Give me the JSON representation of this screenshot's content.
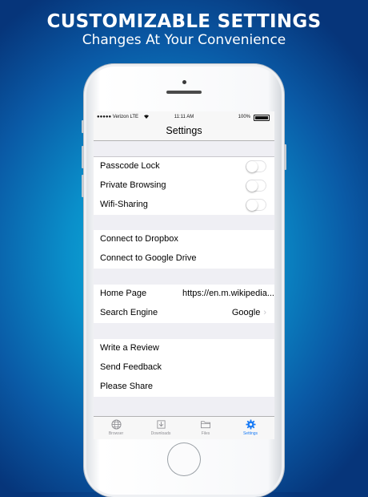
{
  "headline": "CUSTOMIZABLE SETTINGS",
  "subheadline": "Changes At Your Convenience",
  "status_bar": {
    "carrier": "●●●●● Verizon LTE",
    "time": "11:11 AM",
    "battery": "100%"
  },
  "nav": {
    "title": "Settings"
  },
  "sections": {
    "privacy": [
      {
        "label": "Passcode Lock",
        "toggle_on": false
      },
      {
        "label": "Private Browsing",
        "toggle_on": false
      },
      {
        "label": "Wifi-Sharing",
        "toggle_on": false
      }
    ],
    "cloud": [
      {
        "label": "Connect to Dropbox"
      },
      {
        "label": "Connect to Google Drive"
      }
    ],
    "browser": [
      {
        "label": "Home Page",
        "value": "https://en.m.wikipedia..."
      },
      {
        "label": "Search Engine",
        "value": "Google"
      }
    ],
    "feedback": [
      {
        "label": "Write a Review"
      },
      {
        "label": "Send Feedback"
      },
      {
        "label": "Please Share"
      }
    ]
  },
  "tab_bar": {
    "tabs": [
      {
        "label": "Browser",
        "icon": "globe-icon"
      },
      {
        "label": "Downloads",
        "icon": "download-icon"
      },
      {
        "label": "Files",
        "icon": "folder-icon"
      },
      {
        "label": "Settings",
        "icon": "gear-icon",
        "active": true
      }
    ]
  },
  "colors": {
    "accent": "#1b7cf5",
    "background_top": "#06357a",
    "background_center": "#10bfe0"
  }
}
